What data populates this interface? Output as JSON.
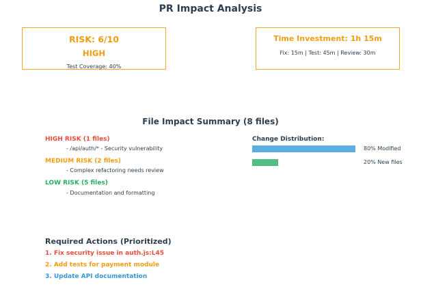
{
  "title": "PR Impact Analysis",
  "risk_card": {
    "score": "RISK: 6/10",
    "level": "HIGH",
    "coverage": "Test Coverage: 40%"
  },
  "time_card": {
    "title": "Time Investment: 1h 15m",
    "breakdown": "Fix: 15m | Test: 45m | Review: 30m"
  },
  "file_summary": {
    "title": "File Impact Summary (8 files)",
    "categories": [
      {
        "label": "HIGH RISK (1 files)",
        "description": "- /api/auth/* - Security vulnerability",
        "color": "#e74c3c"
      },
      {
        "label": "MEDIUM RISK (2 files)",
        "description": "- Complex refactoring needs review",
        "color": "#f39c12"
      },
      {
        "label": "LOW RISK (5 files)",
        "description": "- Documentation and formatting",
        "color": "#27ae60"
      }
    ]
  },
  "change_distribution": {
    "title": "Change Distribution:",
    "items": [
      {
        "label": "80% Modified",
        "fraction": 0.8,
        "color": "#5dade2"
      },
      {
        "label": "20% New files",
        "fraction": 0.2,
        "color": "#52be80"
      }
    ]
  },
  "actions": {
    "title": "Required Actions (Prioritized)",
    "items": [
      {
        "text": "1. Fix security issue in auth.js:L45",
        "color": "#e74c3c"
      },
      {
        "text": "2. Add tests for payment module",
        "color": "#f39c12"
      },
      {
        "text": "3. Update API documentation",
        "color": "#3498db"
      }
    ]
  }
}
